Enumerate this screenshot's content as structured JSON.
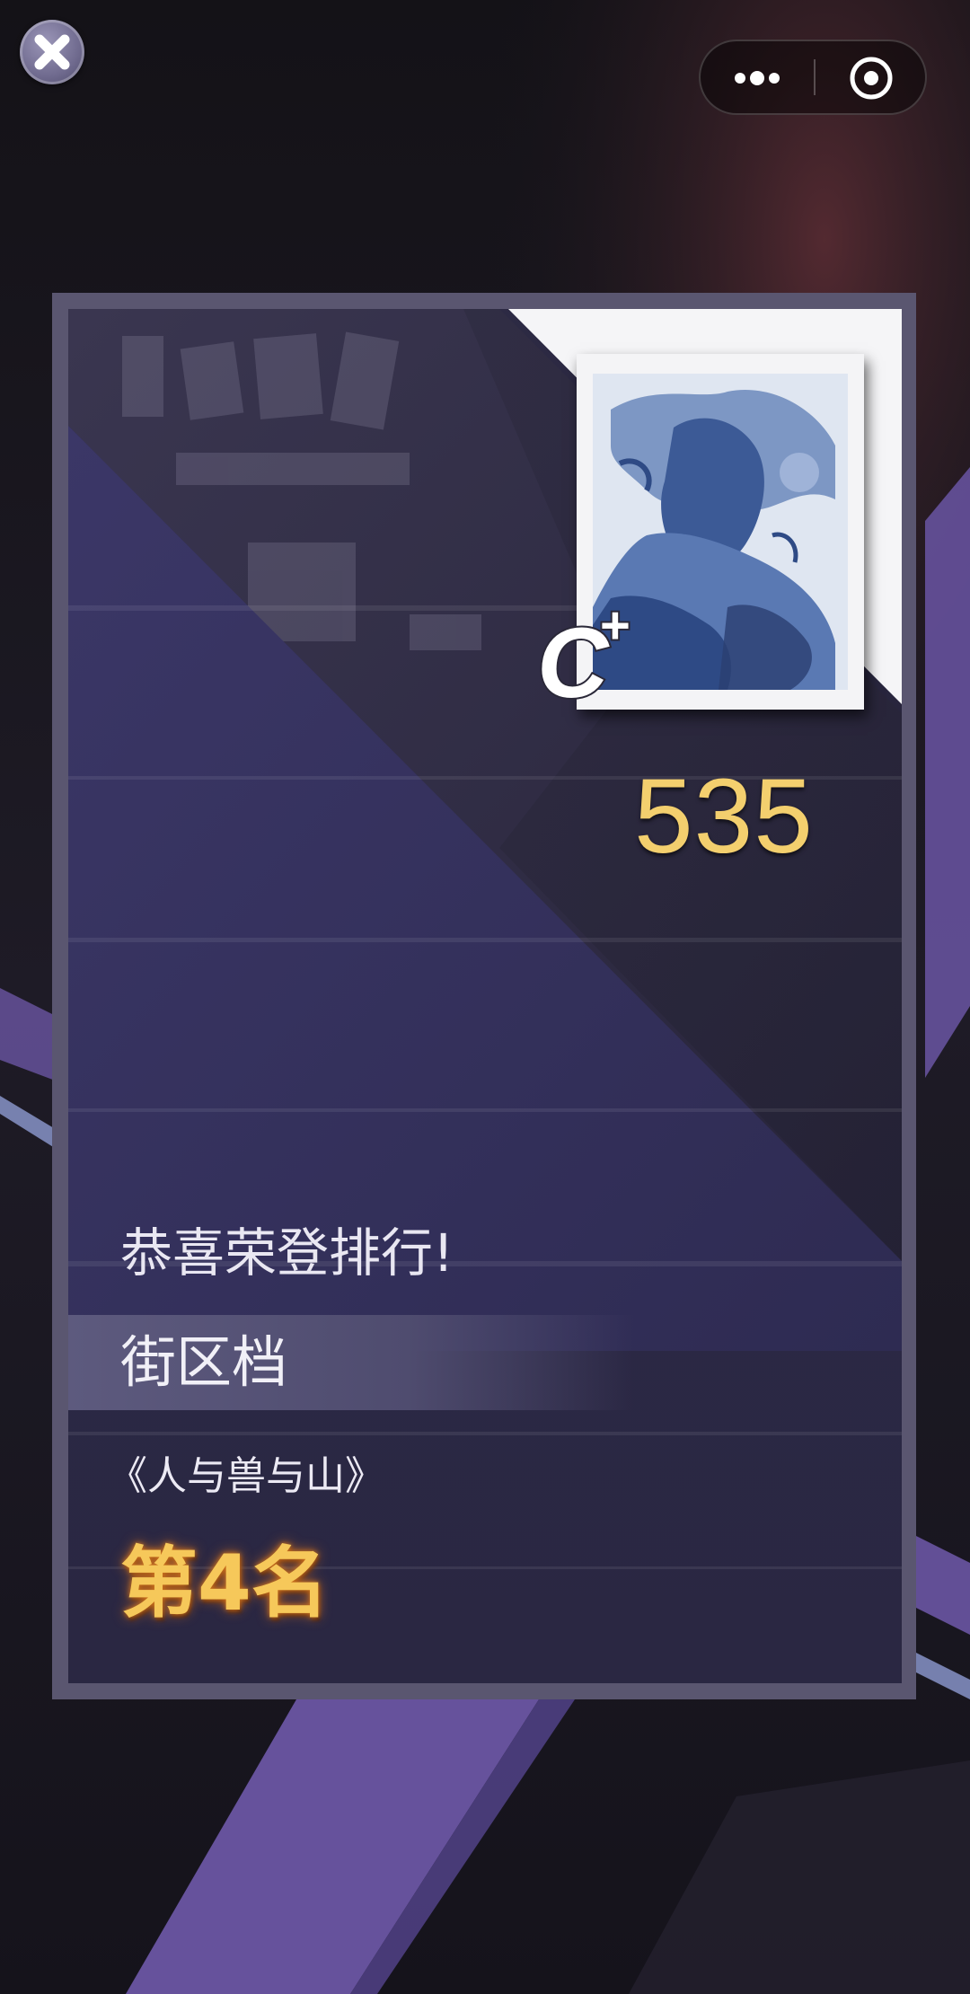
{
  "topbar": {
    "close_icon": "close-icon",
    "more_icon": "more-dots-icon",
    "target_icon": "target-circle-icon"
  },
  "result_card": {
    "cover_icon": "album-cover-ink-painting",
    "grade": "C+",
    "grade_letter": "C",
    "grade_modifier": "+",
    "score": "535",
    "congrats_text": "恭喜荣登排行!",
    "tier_label": "街区档",
    "song_title": "《人与兽与山》",
    "rank_text": "第4名"
  },
  "colors": {
    "score_gold": "#f3cf6e",
    "rank_orange": "#f6c85a",
    "accent_purple": "#6a55a3"
  }
}
